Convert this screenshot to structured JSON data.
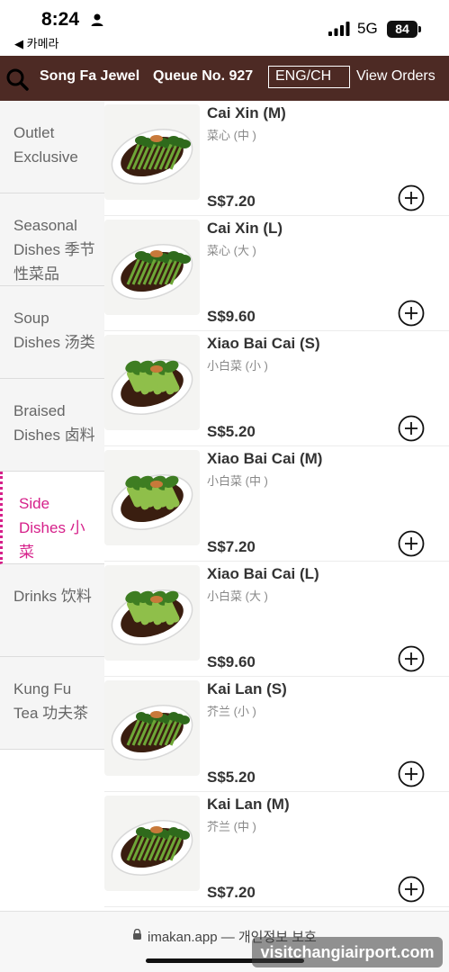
{
  "status_bar": {
    "time": "8:24",
    "back_app": "◀ 카메라",
    "network": "5G",
    "battery": "84"
  },
  "header": {
    "shop_name": "Song Fa Jewel",
    "queue_no": "Queue No. 927",
    "language_toggle": "ENG/CH",
    "view_orders": "View Orders"
  },
  "sidebar": {
    "items": [
      {
        "label": "Outlet Exclusive",
        "active": false
      },
      {
        "label": "Seasonal Dishes 季节性菜品",
        "active": false
      },
      {
        "label": "Soup Dishes 汤类",
        "active": false
      },
      {
        "label": "Braised Dishes 卤料",
        "active": false
      },
      {
        "label": "Side Dishes 小菜",
        "active": true
      },
      {
        "label": "Drinks 饮料",
        "active": false
      },
      {
        "label": "Kung Fu Tea 功夫茶",
        "active": false
      }
    ]
  },
  "products": [
    {
      "name": "Cai Xin (M)",
      "name_cn": "菜心 (中 )",
      "price": "S$7.20",
      "veg": "caixin"
    },
    {
      "name": "Cai Xin (L)",
      "name_cn": "菜心 (大 )",
      "price": "S$9.60",
      "veg": "caixin"
    },
    {
      "name": "Xiao Bai Cai (S)",
      "name_cn": "小白菜 (小 )",
      "price": "S$5.20",
      "veg": "baicai"
    },
    {
      "name": "Xiao Bai Cai (M)",
      "name_cn": "小白菜 (中 )",
      "price": "S$7.20",
      "veg": "baicai"
    },
    {
      "name": "Xiao Bai Cai (L)",
      "name_cn": "小白菜 (大 )",
      "price": "S$9.60",
      "veg": "baicai"
    },
    {
      "name": "Kai Lan (S)",
      "name_cn": "芥兰 (小 )",
      "price": "S$5.20",
      "veg": "kailan"
    },
    {
      "name": "Kai Lan (M)",
      "name_cn": "芥兰 (中 )",
      "price": "S$7.20",
      "veg": "kailan"
    }
  ],
  "browser": {
    "url": "imakan.app — 개인정보 보호"
  },
  "watermark": "visitchangiairport.com",
  "colors": {
    "header_bg": "#4d2a24",
    "active_category": "#d6208a"
  }
}
